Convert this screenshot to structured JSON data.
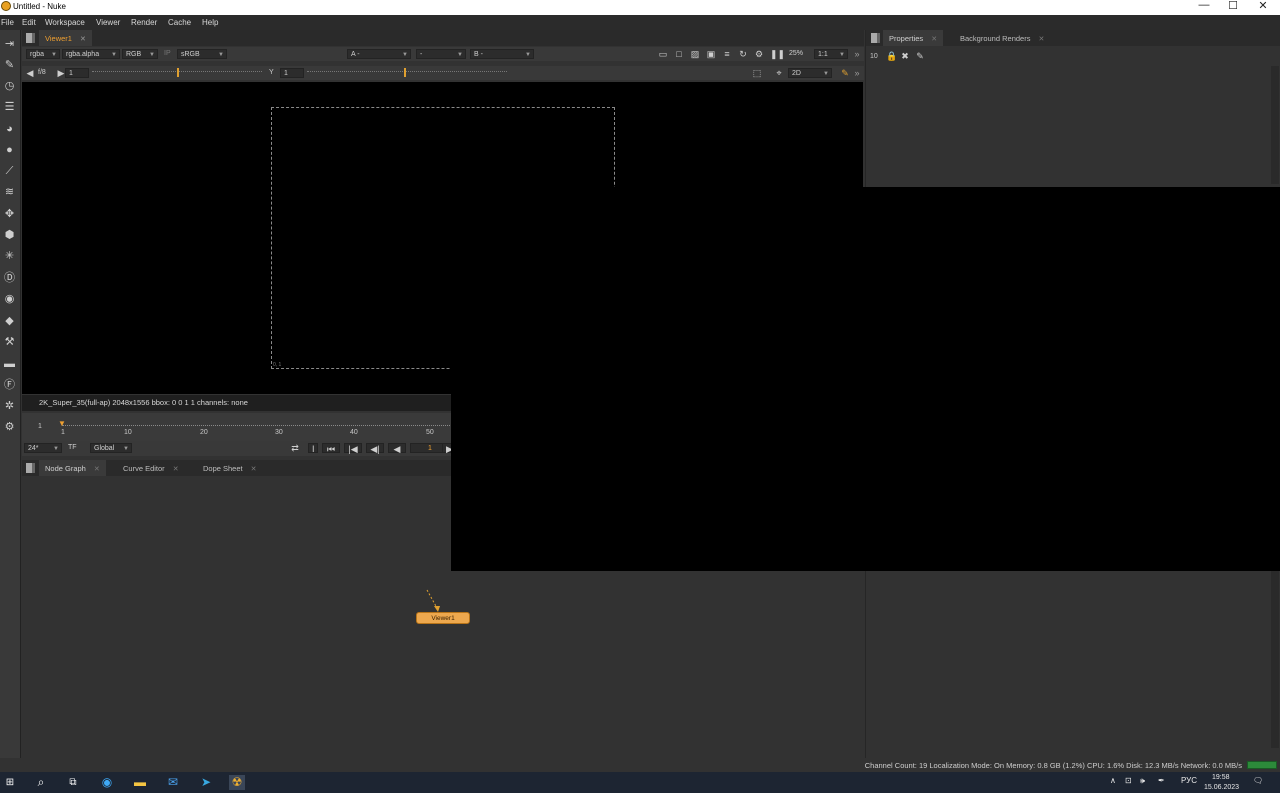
{
  "window": {
    "title": "Untitled - Nuke",
    "controls": {
      "minimize": "—",
      "maximize": "☐",
      "close": "✕"
    }
  },
  "menu": [
    "File",
    "Edit",
    "Workspace",
    "Viewer",
    "Render",
    "Cache",
    "Help"
  ],
  "viewer_panel": {
    "tab": "Viewer1",
    "controls": {
      "channels": "rgba",
      "alpha_channel": "rgba.alpha",
      "display": "RGB",
      "ip": "IP",
      "lut": "sRGB",
      "input_a": "A",
      "input_a_value": "-",
      "input_mid": "-",
      "input_b": "B",
      "input_b_value": "-",
      "zoom": "25%",
      "ratio": "1:1"
    },
    "row2": {
      "fstop": "f/8",
      "gain": "1",
      "y_label": "Y",
      "gamma": "1",
      "view_mode": "2D"
    },
    "format_info": "2K_Super_35(full-ap) 2048x1556  bbox: 0 0 1 1 channels: none",
    "frame_corner": "0, 1"
  },
  "timeline": {
    "start_frame": "1",
    "ticks": [
      "1",
      "10",
      "20",
      "30",
      "40",
      "50"
    ],
    "fps": "24*",
    "tf": "TF",
    "range": "Global",
    "current_frame": "1"
  },
  "bottom_tabs": [
    "Node Graph",
    "Curve Editor",
    "Dope Sheet"
  ],
  "node_graph": {
    "node": {
      "label": "Viewer1",
      "color": "#eda84e"
    }
  },
  "properties_panel": {
    "tabs": [
      "Properties",
      "Background Renders"
    ],
    "max_panels": "10"
  },
  "status_bar": {
    "text": "Channel Count: 19  Localization Mode: On  Memory: 0.8 GB (1.2%)  CPU: 1.6%  Disk: 12.3 MB/s  Network: 0.0 MB/s"
  },
  "taskbar": {
    "lang": "РУС",
    "time": "19:58",
    "date": "15.06.2023"
  },
  "colors": {
    "accent": "#f0a030",
    "node": "#eda84e",
    "bg": "#323232"
  }
}
